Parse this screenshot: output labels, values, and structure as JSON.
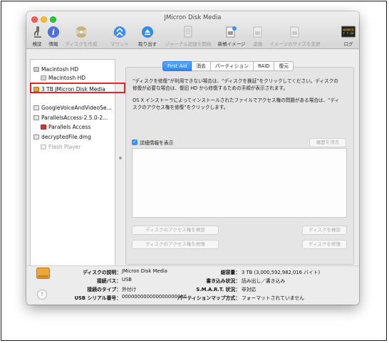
{
  "window": {
    "title": "JMicron Disk Media"
  },
  "toolbar": {
    "verify": "検証",
    "info": "情報",
    "burn": "ディスクを作成",
    "mount": "マウント",
    "eject": "取り出す",
    "enable_journaling": "ジャーナル記録を開始",
    "new_image": "新規イメージ",
    "convert": "変換",
    "resize_image": "イメージのサイズを変更",
    "log": "ログ",
    "log_icon_text1": "WARNIN",
    "log_icon_text2": "Y 7:34"
  },
  "sidebar": {
    "items": [
      {
        "label": "Macintosh HD"
      },
      {
        "label": "Macintosh HD"
      },
      {
        "label": "3 TB JMicron Disk Media"
      },
      {
        "label": "GoogleVoiceAndVideoSe..."
      },
      {
        "label": "ParallelsAccess-2.5.0-2..."
      },
      {
        "label": "Parallels Access"
      },
      {
        "label": "decryptedFile.dmg"
      },
      {
        "label": "Flash Player"
      }
    ]
  },
  "tabs": [
    "First Aid",
    "消去",
    "パーティション",
    "RAID",
    "復元"
  ],
  "first_aid": {
    "para1_line1": "“ディスクを修復”が利用できない場合は、“ディスクを検証”をクリックしてください。ディスクの",
    "para1_line2": "修復が必要な場合は、復旧 HD から修復するための手順が表示されます。",
    "para2_line1": "OS X インストーラによってインストールされたファイルでアクセス権の問題がある場合は、“ディ",
    "para2_line2": "スクのアクセス権を修復”をクリックします。",
    "show_details": "詳細情報を表示",
    "clear_history": "履歴を消去",
    "verify_permissions": "ディスクのアクセス権を検証",
    "repair_permissions": "ディスクのアクセス権を修復",
    "verify_disk": "ディスクを検証",
    "repair_disk": "ディスクを修復"
  },
  "info": {
    "description_label": "ディスクの説明：",
    "description_value": "JMicron Disk Media",
    "bus_label": "接続バス：",
    "bus_value": "USB",
    "type_label": "接続のタイプ：",
    "type_value": "外付け",
    "serial_label": "USB シリアル番号：",
    "serial_value": "000000000000000000000",
    "capacity_label": "総容量：",
    "capacity_value": "3 TB (3,000,592,982,016 バイト)",
    "write_label": "書き込み状況：",
    "write_value": "読み出し／書き込み",
    "smart_label": "S.M.A.R.T. 状況：",
    "smart_value": "非対応",
    "partition_label": "パーティションマップ方式：",
    "partition_value": "フォーマットされていません",
    "help": "?"
  },
  "colors": {
    "accent": "#2f86ef",
    "highlight_box": "#e2242b",
    "drive_orange": "#e9a13a"
  }
}
